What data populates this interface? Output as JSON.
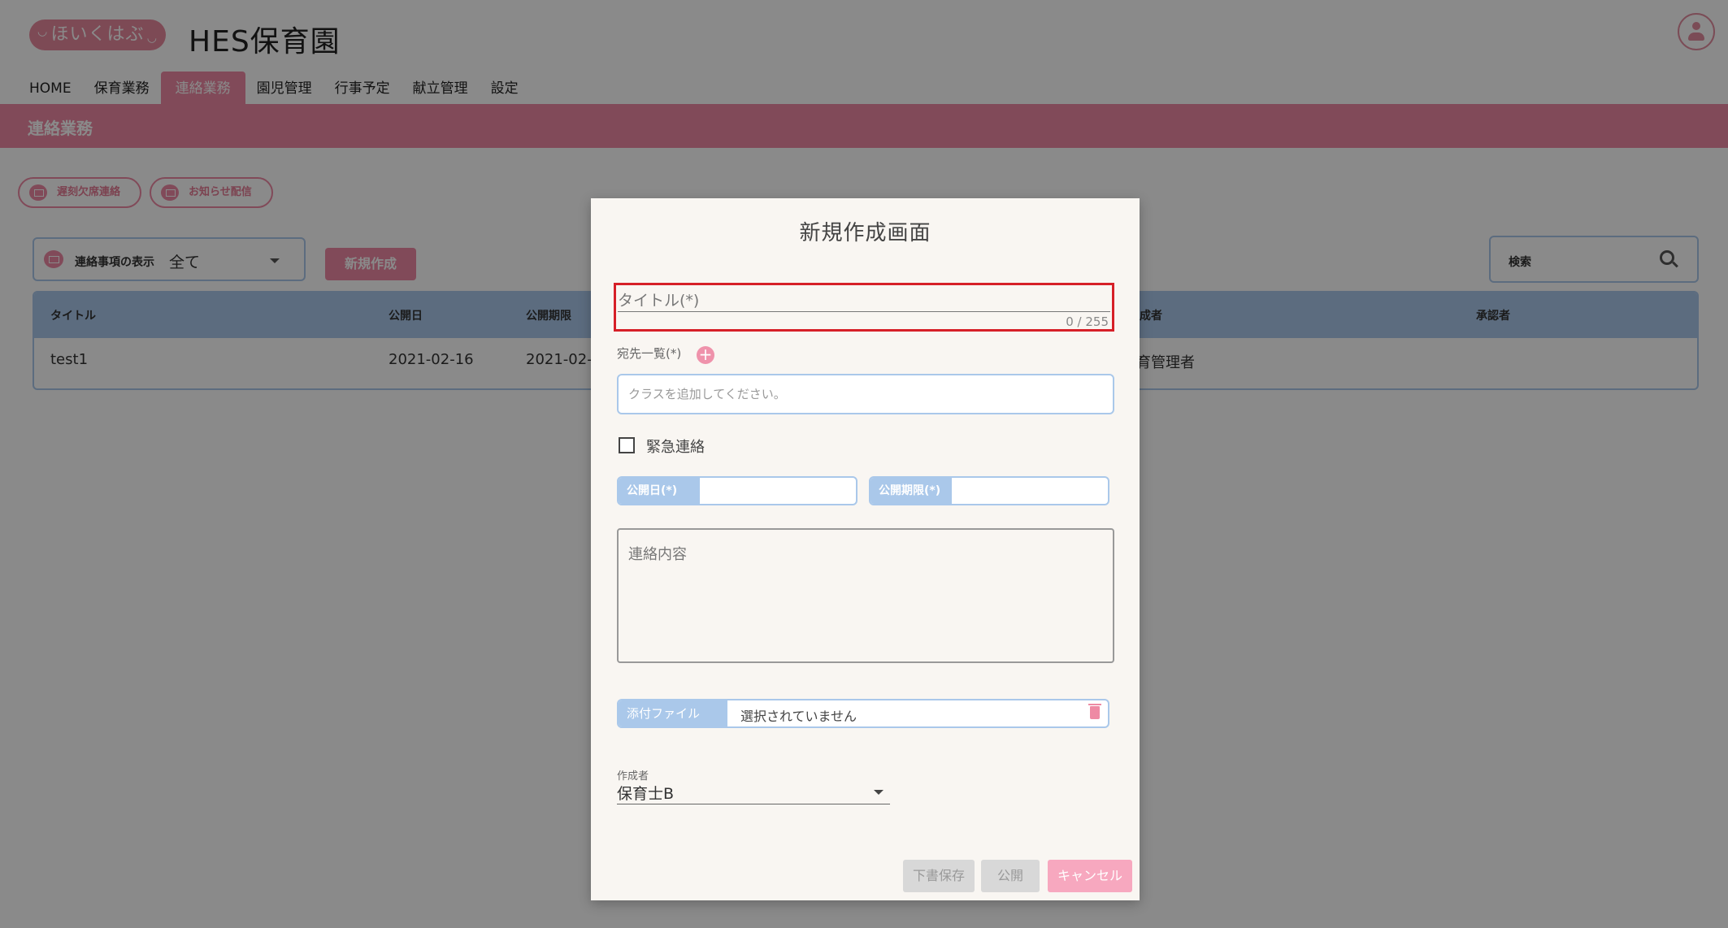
{
  "header": {
    "logo_text": "ほいくはぶ",
    "org_name": "HES保育園"
  },
  "nav": {
    "items": [
      {
        "label": "HOME"
      },
      {
        "label": "保育業務"
      },
      {
        "label": "連絡業務"
      },
      {
        "label": "園児管理"
      },
      {
        "label": "行事予定"
      },
      {
        "label": "献立管理"
      },
      {
        "label": "設定"
      }
    ],
    "active_index": 2
  },
  "section": {
    "title": "連絡業務"
  },
  "actions": {
    "absence_label": "遅刻欠席連絡",
    "notice_label": "お知らせ配信"
  },
  "filter": {
    "label": "連絡事項の表示",
    "value": "全て"
  },
  "new_button_label": "新規作成",
  "search": {
    "label": "検索"
  },
  "table": {
    "columns": [
      "タイトル",
      "公開日",
      "公開期限",
      "成者",
      "承認者"
    ],
    "rows": [
      {
        "title": "test1",
        "published": "2021-02-16",
        "expiry": "2021-02-",
        "author": "育管理者"
      }
    ]
  },
  "modal": {
    "title": "新規作成画面",
    "title_field": {
      "label": "タイトル(*)",
      "counter": "0 / 255"
    },
    "destinations": {
      "label": "宛先一覧(*)",
      "add_icon": "plus-icon",
      "placeholder": "クラスを追加してください。"
    },
    "urgent": {
      "label": "緊急連絡",
      "checked": false
    },
    "publish_date": {
      "label": "公開日(*)"
    },
    "publish_expiry": {
      "label": "公開期限(*)"
    },
    "content": {
      "placeholder": "連絡内容"
    },
    "attachment": {
      "label": "添付ファイル",
      "value": "選択されていません"
    },
    "author": {
      "label": "作成者",
      "value": "保育士B"
    },
    "buttons": {
      "draft": "下書保存",
      "publish": "公開",
      "cancel": "キャンセル"
    }
  },
  "colors": {
    "accent_pink": "#ee8aa4",
    "field_blue": "#aac8ea",
    "highlight_red": "#d62028"
  }
}
